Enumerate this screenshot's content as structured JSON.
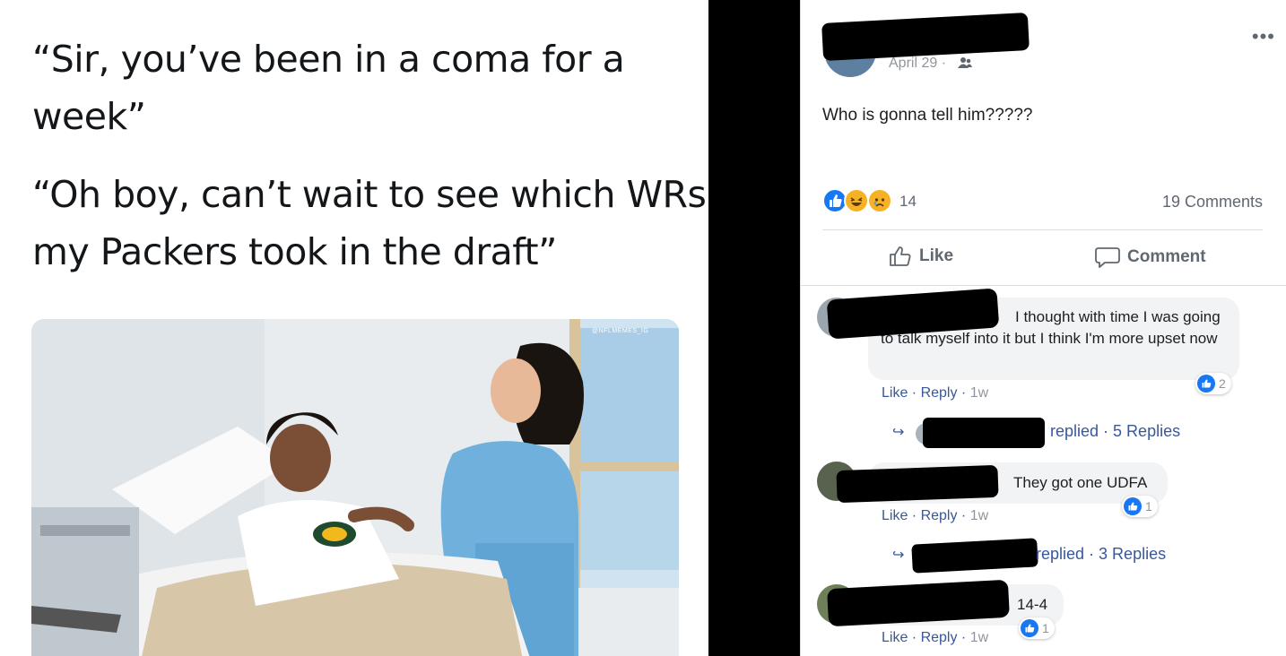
{
  "meme": {
    "line1": "“Sir, you’ve been in a coma for a week”",
    "line1a": "“Sir, you’ve been in a coma for a",
    "line1b": "week”",
    "line2a": "“Oh boy, can’t wait to see which WRs",
    "line2b": "my Packers took in the draft”",
    "watermark": "@NFLMEMES_IG"
  },
  "post": {
    "date": "April 29",
    "separator": "·",
    "text": "Who is gonna tell him?????",
    "reaction_count": "14",
    "comments_count": "19 Comments",
    "like_label": "Like",
    "comment_label": "Comment"
  },
  "comments": [
    {
      "text": "I thought with time I was going to talk myself into it but I think I'm more upset now",
      "like_label": "Like",
      "reply_label": "Reply",
      "age": "1w",
      "likes": "2",
      "replies_summary_prefix": "replied",
      "replies_summary": "5 Replies"
    },
    {
      "text": "They got one UDFA",
      "like_label": "Like",
      "reply_label": "Reply",
      "age": "1w",
      "likes": "1",
      "replies_summary_prefix": "replied",
      "replies_summary": "3 Replies"
    },
    {
      "text": "14-4",
      "like_label": "Like",
      "reply_label": "Reply",
      "age": "1w",
      "likes": "1"
    }
  ],
  "colors": {
    "facebook_blue": "#1877f2",
    "link": "#385898",
    "haha": "#f7b125",
    "online": "#42b72a"
  }
}
